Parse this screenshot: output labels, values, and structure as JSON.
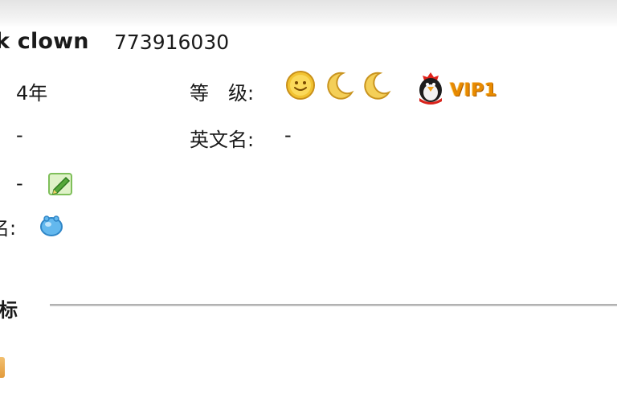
{
  "window": {
    "nickname": "k clown",
    "qq_number": "773916030"
  },
  "profile": {
    "age_value": "4年",
    "level_label": "等　级:",
    "vip_text": "VIP1",
    "row2_label_tail": ":",
    "row2_value": "-",
    "english_name_label": "英文名:",
    "english_name_value": "-",
    "row3_label_tail": ":",
    "row3_value": "-",
    "row4_label_tail": "名:"
  },
  "section": {
    "title_fragment": "标"
  },
  "icons": {
    "level_icons": [
      "sun-smiley-icon",
      "moon-icon",
      "moon-icon"
    ],
    "vip_badge": "qq-penguin-vip-icon",
    "edit_icon": "green-pencil-icon",
    "signature_icon": "blue-chat-bubble-icon"
  },
  "colors": {
    "vip_orange": "#e88a00",
    "sun_yellow": "#f2c331",
    "moon_yellow": "#f4cf58",
    "divider_gray": "#b8b8b8"
  }
}
